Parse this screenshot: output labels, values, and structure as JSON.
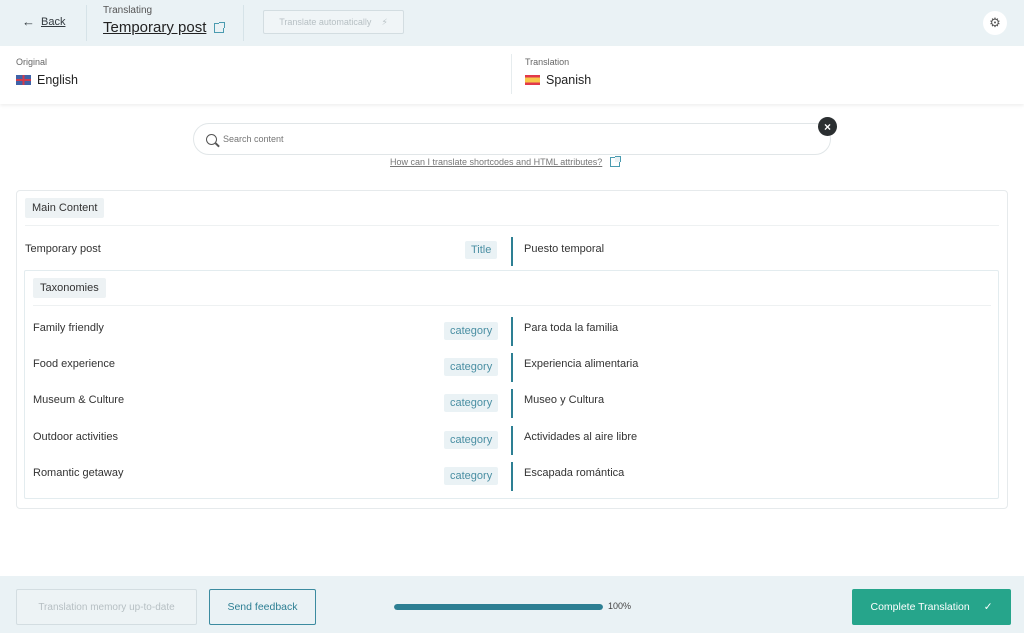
{
  "header": {
    "back_label": "Back",
    "back_icon": "arrow-left-icon",
    "translating_caption": "Translating",
    "post_title": "Temporary post",
    "external_link_icon": "external-link-icon",
    "translate_auto_label": "Translate automatically",
    "translate_auto_icon": "lightning-icon",
    "settings_icon": "gear-icon"
  },
  "languages": {
    "original": {
      "caption": "Original",
      "name": "English",
      "flag": "uk-flag-icon"
    },
    "translation": {
      "caption": "Translation",
      "name": "Spanish",
      "flag": "spain-flag-icon"
    }
  },
  "search": {
    "placeholder": "Search content",
    "value": "",
    "help_link": "How can I translate shortcodes and HTML attributes?"
  },
  "content": {
    "main_section": "Main Content",
    "title_row": {
      "original": "Temporary post",
      "type": "Title",
      "translation": "Puesto temporal"
    },
    "taxonomies_section": "Taxonomies",
    "taxonomy_rows": [
      {
        "original": "Family friendly",
        "type": "category",
        "translation": "Para toda la familia"
      },
      {
        "original": "Food experience",
        "type": "category",
        "translation": "Experiencia alimentaria"
      },
      {
        "original": "Museum & Culture",
        "type": "category",
        "translation": "Museo y Cultura"
      },
      {
        "original": "Outdoor activities",
        "type": "category",
        "translation": "Actividades al aire libre"
      },
      {
        "original": "Romantic getaway",
        "type": "category",
        "translation": "Escapada romántica"
      }
    ]
  },
  "footer": {
    "memory_label": "Translation memory up-to-date",
    "feedback_label": "Send feedback",
    "progress_percent": 100,
    "progress_label": "100%",
    "complete_label": "Complete Translation",
    "complete_icon": "checkmark-icon"
  },
  "colors": {
    "accent": "#2d7f93",
    "complete": "#26a58b",
    "header_bg": "#eaf2f5"
  }
}
